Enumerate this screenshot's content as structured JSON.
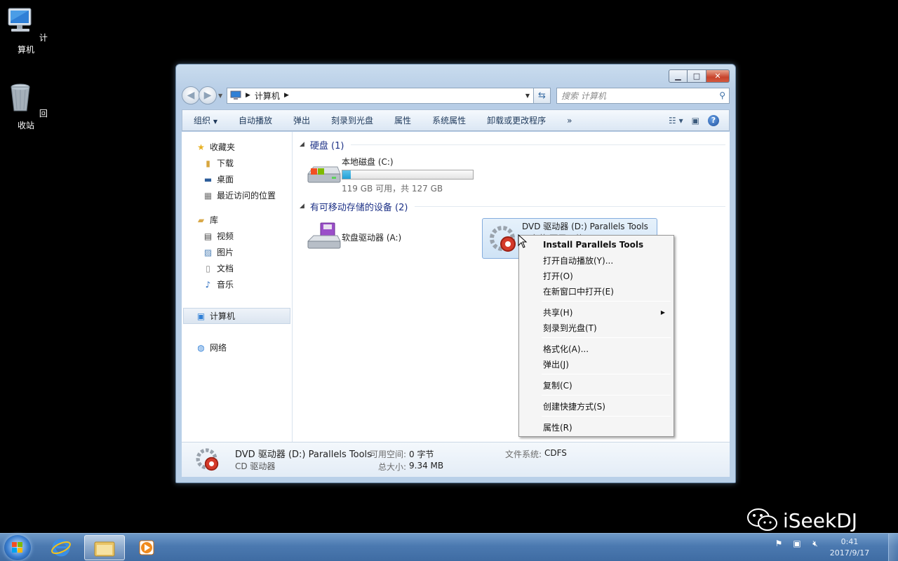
{
  "desktop": {
    "icons": [
      {
        "label": "计算机"
      },
      {
        "label": "回收站"
      }
    ]
  },
  "window": {
    "address": {
      "root_label": "计算机"
    },
    "search": {
      "placeholder": "搜索 计算机"
    },
    "toolbar": {
      "buttons": [
        "组织",
        "自动播放",
        "弹出",
        "刻录到光盘",
        "属性",
        "系统属性",
        "卸载或更改程序",
        "»"
      ]
    },
    "nav": {
      "favorites": {
        "label": "收藏夹",
        "items": [
          "下载",
          "桌面",
          "最近访问的位置"
        ]
      },
      "libraries": {
        "label": "库",
        "items": [
          "视频",
          "图片",
          "文档",
          "音乐"
        ]
      },
      "computer": {
        "label": "计算机"
      },
      "network": {
        "label": "网络"
      }
    },
    "sections": {
      "hdd": {
        "label": "硬盘 (1)"
      },
      "removable": {
        "label": "有可移动存储的设备 (2)"
      }
    },
    "drives": {
      "c": {
        "name": "本地磁盘 (C:)",
        "size": "119 GB 可用，共 127 GB",
        "used_fraction": 0.063
      },
      "a": {
        "name": "软盘驱动器 (A:)"
      },
      "d": {
        "name": "DVD 驱动器 (D:) Parallels Tools",
        "size": "0 字节 可用，共 9.34 MB"
      }
    },
    "status": {
      "name": "DVD 驱动器 (D:) Parallels Tools",
      "type": "CD 驱动器",
      "free_key": "可用空间:",
      "free_val": "0 字节",
      "total_key": "总大小:",
      "total_val": "9.34 MB",
      "fs_key": "文件系统:",
      "fs_val": "CDFS"
    }
  },
  "context_menu": {
    "groups": [
      [
        "Install Parallels Tools",
        "打开自动播放(Y)...",
        "打开(O)",
        "在新窗口中打开(E)"
      ],
      [
        "共享(H)",
        "刻录到光盘(T)"
      ],
      [
        "格式化(A)...",
        "弹出(J)"
      ],
      [
        "复制(C)"
      ],
      [
        "创建快捷方式(S)"
      ],
      [
        "属性(R)"
      ]
    ]
  },
  "taskbar": {
    "clock_time": "0:41",
    "clock_date": "2017/9/17"
  },
  "watermark": {
    "text": "iSeekDJ"
  },
  "colors": {
    "accent": "#1e3287",
    "taskbar": "#4b79b0"
  }
}
